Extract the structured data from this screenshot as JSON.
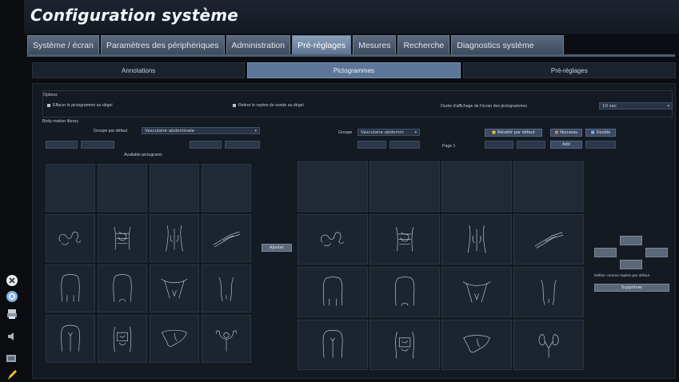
{
  "app": {
    "title": "Configuration système"
  },
  "tabs": [
    {
      "label": "Système / écran",
      "active": false
    },
    {
      "label": "Paramètres des périphériques",
      "active": false
    },
    {
      "label": "Administration",
      "active": false
    },
    {
      "label": "Pré-réglages",
      "active": true
    },
    {
      "label": "Mesures",
      "active": false
    },
    {
      "label": "Recherche",
      "active": false
    },
    {
      "label": "Diagnostics système",
      "active": false
    }
  ],
  "subtabs": [
    {
      "label": "Annotations",
      "active": false
    },
    {
      "label": "Pictogrammes",
      "active": true
    },
    {
      "label": "Pré-réglages",
      "active": false
    }
  ],
  "options": {
    "heading": "Options",
    "erase_label": "Effacer le pictogramme au dégel",
    "remove_probe_label": "Retirer le repère de sonde au dégel",
    "duration_label": "Durée d'affichage de l'écran des pictogrammes",
    "duration_value": "10 sec"
  },
  "library": {
    "heading": "Body marker library",
    "default_group_label": "Groupe par défaut",
    "default_group_value": "Vasculaire abdominale",
    "available_label": "Available pictograms",
    "groups_label": "Groupe",
    "groups_value": "Vasculaire abdomin",
    "page_label": "Page 1",
    "restore_label": "Rétablir par défaut",
    "new_label": "Nouveau",
    "duplicate_label": "Double",
    "add_label": "Add",
    "transfer_label": "Ajouter",
    "set_default_label": "Définir comme repère par défaut",
    "delete_label": "Supprimer"
  },
  "left_icons": [
    "close-circle-icon",
    "help-circle-icon",
    "printer-icon",
    "volume-icon",
    "screen-icon",
    "pen-icon"
  ],
  "available_grid": [
    "",
    "",
    "",
    "",
    "colon",
    "abdomen-front",
    "kidneys-back",
    "arm-vessel",
    "torso-front",
    "torso-back",
    "pelvis",
    "abdomen-side",
    "chest-front",
    "torso-organs",
    "liver",
    "uterus"
  ],
  "group_grid": [
    "",
    "",
    "",
    "",
    "colon",
    "abdomen-front",
    "kidneys-back",
    "arm-vessel",
    "torso-front",
    "torso-back",
    "pelvis",
    "abdomen-side",
    "chest-front",
    "torso-organs",
    "liver",
    "kidneys"
  ],
  "colors": {
    "accent": "#5c7697",
    "background": "#0b0d12",
    "panel": "#141a22"
  }
}
